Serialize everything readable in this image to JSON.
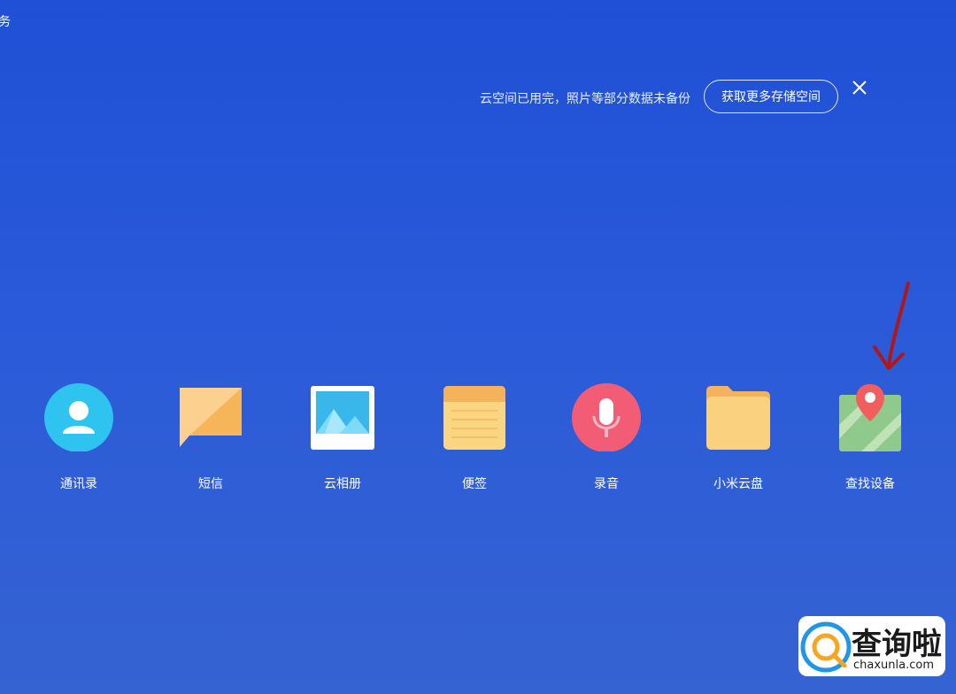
{
  "corner": {
    "text": "务"
  },
  "notice": {
    "message": "云空间已用完，照片等部分数据未备份",
    "button_label": "获取更多存储空间",
    "close_icon": "close-icon"
  },
  "apps": [
    {
      "label": "通讯录",
      "icon": "contacts-icon",
      "color": "#2fc3f0"
    },
    {
      "label": "短信",
      "icon": "messages-icon",
      "color": "#f7b55a"
    },
    {
      "label": "云相册",
      "icon": "gallery-icon",
      "color": "#39b6ea"
    },
    {
      "label": "便签",
      "icon": "notes-icon",
      "color": "#f7c15d"
    },
    {
      "label": "录音",
      "icon": "recorder-icon",
      "color": "#f25d75"
    },
    {
      "label": "小米云盘",
      "icon": "cloud-drive-icon",
      "color": "#f8c96a"
    },
    {
      "label": "查找设备",
      "icon": "find-device-icon",
      "color": "#8fc98c"
    }
  ],
  "watermark": {
    "title": "查询啦",
    "url": "chaxunla.com"
  },
  "colors": {
    "background": "#2656d6",
    "annotation_arrow": "#b01818"
  }
}
